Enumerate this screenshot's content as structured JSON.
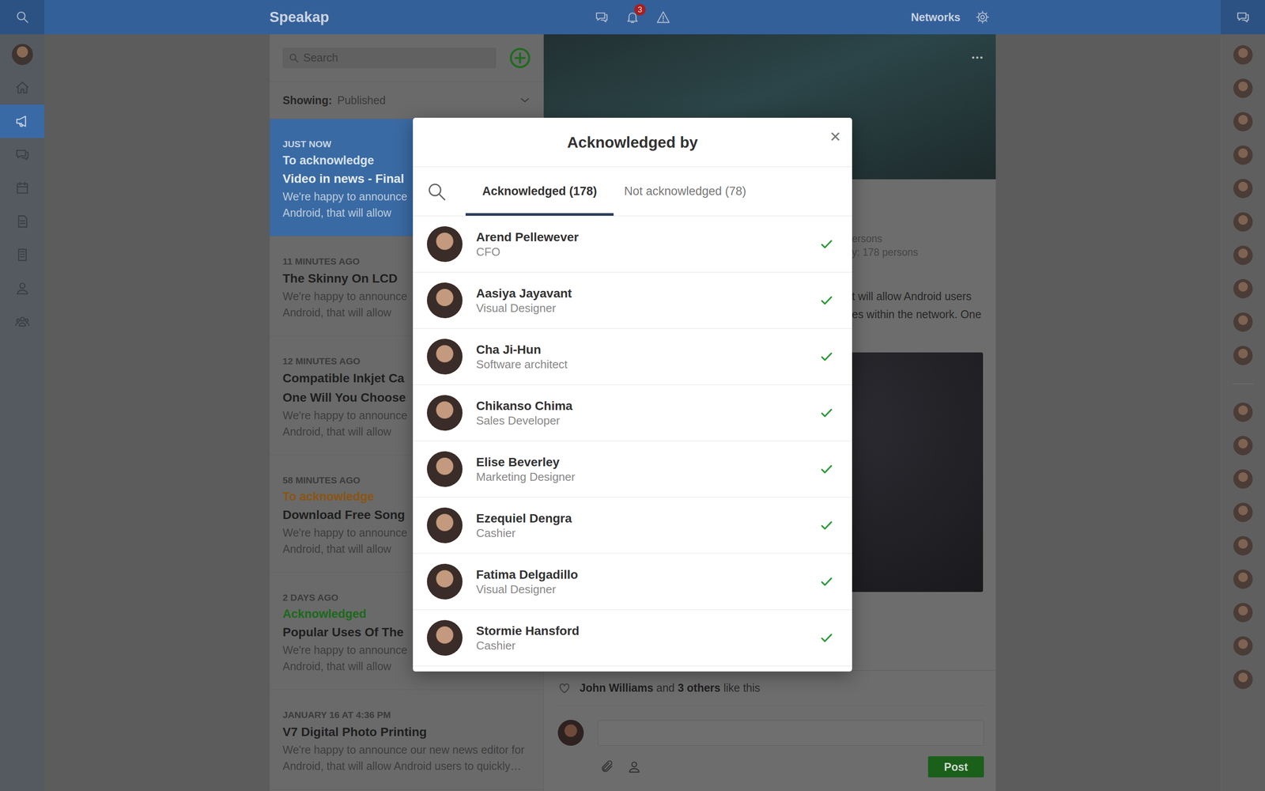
{
  "app": {
    "logo": "Speakap",
    "networks": "Networks",
    "notificationBadge": "3"
  },
  "sidebar": {
    "items": [
      {
        "kind": "home",
        "selected": false
      },
      {
        "kind": "announcements",
        "selected": true
      },
      {
        "kind": "chat",
        "selected": false
      },
      {
        "kind": "calendar",
        "selected": false
      },
      {
        "kind": "documents",
        "selected": false
      },
      {
        "kind": "organization",
        "selected": false
      },
      {
        "kind": "people",
        "selected": false
      },
      {
        "kind": "groups",
        "selected": false
      }
    ]
  },
  "feed": {
    "search": {
      "placeholder": "Search"
    },
    "filter": {
      "label": "Showing:",
      "value": "Published"
    },
    "items": [
      {
        "time": "JUST NOW",
        "status": {
          "text": "To acknowledge",
          "color": "#d6e1ee"
        },
        "title": [
          "Video in news - Final"
        ],
        "body": [
          "We're happy to announce",
          "Android, that will allow"
        ],
        "selected": true
      },
      {
        "time": "11 MINUTES AGO",
        "status": null,
        "title": [
          "The Skinny On LCD"
        ],
        "body": [
          "We're happy to announce",
          "Android, that will allow"
        ],
        "selected": false
      },
      {
        "time": "12 MINUTES AGO",
        "status": null,
        "title": [
          "Compatible Inkjet Ca",
          "One Will You Choose"
        ],
        "body": [
          "We're happy to announce",
          "Android, that will allow"
        ],
        "selected": false
      },
      {
        "time": "58 MINUTES AGO",
        "status": {
          "text": "To acknowledge",
          "color": "#8a5510"
        },
        "title": [
          "Download Free Song"
        ],
        "body": [
          "We're happy to announce",
          "Android, that will allow"
        ],
        "selected": false
      },
      {
        "time": "2 DAYS AGO",
        "status": {
          "text": "Acknowledged",
          "color": "#1a6a1a"
        },
        "title": [
          "Popular Uses Of The"
        ],
        "body": [
          "We're happy to announce",
          "Android, that will allow"
        ],
        "selected": false
      },
      {
        "time": "JANUARY 16 AT 4:36 PM",
        "status": null,
        "title": [
          "V7 Digital Photo Printing"
        ],
        "body": [
          "We're happy to announce our new news editor for",
          "Android, that will allow Android users to quickly…"
        ],
        "selected": false
      }
    ]
  },
  "post": {
    "meta": [
      "ersons",
      "y: 178 persons"
    ],
    "body": [
      "t will allow Android users",
      "es within the network. One"
    ],
    "likes": {
      "names": "John Williams",
      "joiner": "and",
      "others": "3 others",
      "suffix": "like this"
    },
    "postButton": "Post"
  },
  "modal": {
    "title": "Acknowledged by",
    "close": "×",
    "tabs": [
      {
        "label": "Acknowledged (178)",
        "selected": true
      },
      {
        "label": "Not acknowledged (78)",
        "selected": false
      }
    ],
    "people": [
      {
        "name": "Arend Pellewever",
        "role": "CFO",
        "acknowledged": true
      },
      {
        "name": "Aasiya Jayavant",
        "role": "Visual Designer",
        "acknowledged": true
      },
      {
        "name": "Cha Ji-Hun",
        "role": "Software architect",
        "acknowledged": true
      },
      {
        "name": "Chikanso Chima",
        "role": "Sales Developer",
        "acknowledged": true
      },
      {
        "name": "Elise Beverley",
        "role": "Marketing Designer",
        "acknowledged": true
      },
      {
        "name": "Ezequiel Dengra",
        "role": "Cashier",
        "acknowledged": true
      },
      {
        "name": "Fatima Delgadillo",
        "role": "Visual Designer",
        "acknowledged": true
      },
      {
        "name": "Stormie Hansford",
        "role": "Cashier",
        "acknowledged": true
      }
    ]
  }
}
